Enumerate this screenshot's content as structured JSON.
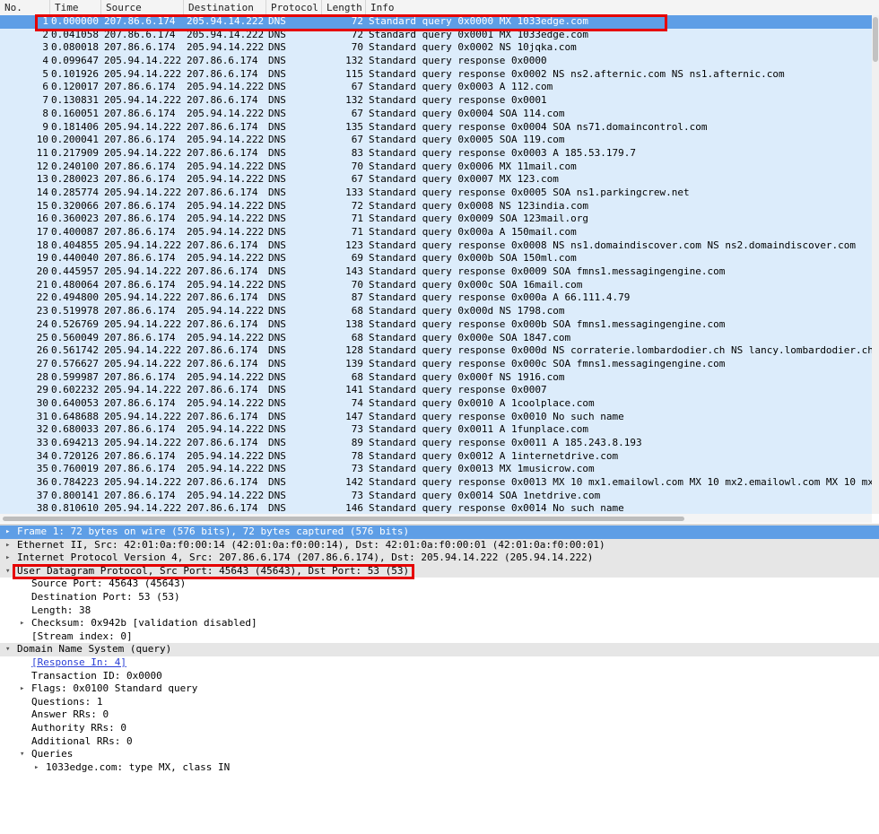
{
  "packet_list": {
    "columns": [
      "No.",
      "Time",
      "Source",
      "Destination",
      "Protocol",
      "Length",
      "Info"
    ],
    "rows": [
      {
        "no": "1",
        "time": "0.000000",
        "src": "207.86.6.174",
        "dst": "205.94.14.222",
        "proto": "DNS",
        "len": "72",
        "info": "Standard query 0x0000  MX 1033edge.com",
        "selected": true
      },
      {
        "no": "2",
        "time": "0.041058",
        "src": "207.86.6.174",
        "dst": "205.94.14.222",
        "proto": "DNS",
        "len": "72",
        "info": "Standard query 0x0001  MX 1033edge.com"
      },
      {
        "no": "3",
        "time": "0.080018",
        "src": "207.86.6.174",
        "dst": "205.94.14.222",
        "proto": "DNS",
        "len": "70",
        "info": "Standard query 0x0002  NS 10jqka.com"
      },
      {
        "no": "4",
        "time": "0.099647",
        "src": "205.94.14.222",
        "dst": "207.86.6.174",
        "proto": "DNS",
        "len": "132",
        "info": "Standard query response 0x0000"
      },
      {
        "no": "5",
        "time": "0.101926",
        "src": "205.94.14.222",
        "dst": "207.86.6.174",
        "proto": "DNS",
        "len": "115",
        "info": "Standard query response 0x0002  NS ns2.afternic.com NS ns1.afternic.com"
      },
      {
        "no": "6",
        "time": "0.120017",
        "src": "207.86.6.174",
        "dst": "205.94.14.222",
        "proto": "DNS",
        "len": "67",
        "info": "Standard query 0x0003  A 112.com"
      },
      {
        "no": "7",
        "time": "0.130831",
        "src": "205.94.14.222",
        "dst": "207.86.6.174",
        "proto": "DNS",
        "len": "132",
        "info": "Standard query response 0x0001"
      },
      {
        "no": "8",
        "time": "0.160051",
        "src": "207.86.6.174",
        "dst": "205.94.14.222",
        "proto": "DNS",
        "len": "67",
        "info": "Standard query 0x0004  SOA 114.com"
      },
      {
        "no": "9",
        "time": "0.181406",
        "src": "205.94.14.222",
        "dst": "207.86.6.174",
        "proto": "DNS",
        "len": "135",
        "info": "Standard query response 0x0004  SOA ns71.domaincontrol.com"
      },
      {
        "no": "10",
        "time": "0.200041",
        "src": "207.86.6.174",
        "dst": "205.94.14.222",
        "proto": "DNS",
        "len": "67",
        "info": "Standard query 0x0005  SOA 119.com"
      },
      {
        "no": "11",
        "time": "0.217909",
        "src": "205.94.14.222",
        "dst": "207.86.6.174",
        "proto": "DNS",
        "len": "83",
        "info": "Standard query response 0x0003  A 185.53.179.7"
      },
      {
        "no": "12",
        "time": "0.240100",
        "src": "207.86.6.174",
        "dst": "205.94.14.222",
        "proto": "DNS",
        "len": "70",
        "info": "Standard query 0x0006  MX 11mail.com"
      },
      {
        "no": "13",
        "time": "0.280023",
        "src": "207.86.6.174",
        "dst": "205.94.14.222",
        "proto": "DNS",
        "len": "67",
        "info": "Standard query 0x0007  MX 123.com"
      },
      {
        "no": "14",
        "time": "0.285774",
        "src": "205.94.14.222",
        "dst": "207.86.6.174",
        "proto": "DNS",
        "len": "133",
        "info": "Standard query response 0x0005  SOA ns1.parkingcrew.net"
      },
      {
        "no": "15",
        "time": "0.320066",
        "src": "207.86.6.174",
        "dst": "205.94.14.222",
        "proto": "DNS",
        "len": "72",
        "info": "Standard query 0x0008  NS 123india.com"
      },
      {
        "no": "16",
        "time": "0.360023",
        "src": "207.86.6.174",
        "dst": "205.94.14.222",
        "proto": "DNS",
        "len": "71",
        "info": "Standard query 0x0009  SOA 123mail.org"
      },
      {
        "no": "17",
        "time": "0.400087",
        "src": "207.86.6.174",
        "dst": "205.94.14.222",
        "proto": "DNS",
        "len": "71",
        "info": "Standard query 0x000a  A 150mail.com"
      },
      {
        "no": "18",
        "time": "0.404855",
        "src": "205.94.14.222",
        "dst": "207.86.6.174",
        "proto": "DNS",
        "len": "123",
        "info": "Standard query response 0x0008  NS ns1.domaindiscover.com NS ns2.domaindiscover.com"
      },
      {
        "no": "19",
        "time": "0.440040",
        "src": "207.86.6.174",
        "dst": "205.94.14.222",
        "proto": "DNS",
        "len": "69",
        "info": "Standard query 0x000b  SOA 150ml.com"
      },
      {
        "no": "20",
        "time": "0.445957",
        "src": "205.94.14.222",
        "dst": "207.86.6.174",
        "proto": "DNS",
        "len": "143",
        "info": "Standard query response 0x0009  SOA fmns1.messagingengine.com"
      },
      {
        "no": "21",
        "time": "0.480064",
        "src": "207.86.6.174",
        "dst": "205.94.14.222",
        "proto": "DNS",
        "len": "70",
        "info": "Standard query 0x000c  SOA 16mail.com"
      },
      {
        "no": "22",
        "time": "0.494800",
        "src": "205.94.14.222",
        "dst": "207.86.6.174",
        "proto": "DNS",
        "len": "87",
        "info": "Standard query response 0x000a  A 66.111.4.79"
      },
      {
        "no": "23",
        "time": "0.519978",
        "src": "207.86.6.174",
        "dst": "205.94.14.222",
        "proto": "DNS",
        "len": "68",
        "info": "Standard query 0x000d  NS 1798.com"
      },
      {
        "no": "24",
        "time": "0.526769",
        "src": "205.94.14.222",
        "dst": "207.86.6.174",
        "proto": "DNS",
        "len": "138",
        "info": "Standard query response 0x000b  SOA fmns1.messagingengine.com"
      },
      {
        "no": "25",
        "time": "0.560049",
        "src": "207.86.6.174",
        "dst": "205.94.14.222",
        "proto": "DNS",
        "len": "68",
        "info": "Standard query 0x000e  SOA 1847.com"
      },
      {
        "no": "26",
        "time": "0.561742",
        "src": "205.94.14.222",
        "dst": "207.86.6.174",
        "proto": "DNS",
        "len": "128",
        "info": "Standard query response 0x000d  NS corraterie.lombardodier.ch NS lancy.lombardodier.ch"
      },
      {
        "no": "27",
        "time": "0.576627",
        "src": "205.94.14.222",
        "dst": "207.86.6.174",
        "proto": "DNS",
        "len": "139",
        "info": "Standard query response 0x000c  SOA fmns1.messagingengine.com"
      },
      {
        "no": "28",
        "time": "0.599987",
        "src": "207.86.6.174",
        "dst": "205.94.14.222",
        "proto": "DNS",
        "len": "68",
        "info": "Standard query 0x000f  NS 1916.com"
      },
      {
        "no": "29",
        "time": "0.602232",
        "src": "205.94.14.222",
        "dst": "207.86.6.174",
        "proto": "DNS",
        "len": "141",
        "info": "Standard query response 0x0007"
      },
      {
        "no": "30",
        "time": "0.640053",
        "src": "207.86.6.174",
        "dst": "205.94.14.222",
        "proto": "DNS",
        "len": "74",
        "info": "Standard query 0x0010  A 1coolplace.com"
      },
      {
        "no": "31",
        "time": "0.648688",
        "src": "205.94.14.222",
        "dst": "207.86.6.174",
        "proto": "DNS",
        "len": "147",
        "info": "Standard query response 0x0010 No such name"
      },
      {
        "no": "32",
        "time": "0.680033",
        "src": "207.86.6.174",
        "dst": "205.94.14.222",
        "proto": "DNS",
        "len": "73",
        "info": "Standard query 0x0011  A 1funplace.com"
      },
      {
        "no": "33",
        "time": "0.694213",
        "src": "205.94.14.222",
        "dst": "207.86.6.174",
        "proto": "DNS",
        "len": "89",
        "info": "Standard query response 0x0011  A 185.243.8.193"
      },
      {
        "no": "34",
        "time": "0.720126",
        "src": "207.86.6.174",
        "dst": "205.94.14.222",
        "proto": "DNS",
        "len": "78",
        "info": "Standard query 0x0012  A 1internetdrive.com"
      },
      {
        "no": "35",
        "time": "0.760019",
        "src": "207.86.6.174",
        "dst": "205.94.14.222",
        "proto": "DNS",
        "len": "73",
        "info": "Standard query 0x0013  MX 1musicrow.com"
      },
      {
        "no": "36",
        "time": "0.784223",
        "src": "205.94.14.222",
        "dst": "207.86.6.174",
        "proto": "DNS",
        "len": "142",
        "info": "Standard query response 0x0013  MX 10 mx1.emailowl.com MX 10 mx2.emailowl.com MX 10 mx"
      },
      {
        "no": "37",
        "time": "0.800141",
        "src": "207.86.6.174",
        "dst": "205.94.14.222",
        "proto": "DNS",
        "len": "73",
        "info": "Standard query 0x0014  SOA 1netdrive.com"
      },
      {
        "no": "38",
        "time": "0.810610",
        "src": "205.94.14.222",
        "dst": "207.86.6.174",
        "proto": "DNS",
        "len": "146",
        "info": "Standard query response 0x0014 No such name"
      }
    ]
  },
  "details": [
    {
      "depth": 0,
      "arrow": "collapsed",
      "text": "Frame 1: 72 bytes on wire (576 bits), 72 bytes captured (576 bits)",
      "style": "sel"
    },
    {
      "depth": 0,
      "arrow": "collapsed",
      "text": "Ethernet II, Src: 42:01:0a:f0:00:14 (42:01:0a:f0:00:14), Dst: 42:01:0a:f0:00:01 (42:01:0a:f0:00:01)",
      "style": "band"
    },
    {
      "depth": 0,
      "arrow": "collapsed",
      "text": "Internet Protocol Version 4, Src: 207.86.6.174 (207.86.6.174), Dst: 205.94.14.222 (205.94.14.222)",
      "style": "band"
    },
    {
      "depth": 0,
      "arrow": "expanded",
      "text": "User Datagram Protocol, Src Port: 45643 (45643), Dst Port: 53 (53)",
      "style": "band"
    },
    {
      "depth": 1,
      "arrow": "none",
      "text": "Source Port: 45643 (45643)"
    },
    {
      "depth": 1,
      "arrow": "none",
      "text": "Destination Port: 53 (53)"
    },
    {
      "depth": 1,
      "arrow": "none",
      "text": "Length: 38"
    },
    {
      "depth": 1,
      "arrow": "collapsed",
      "text": "Checksum: 0x942b [validation disabled]"
    },
    {
      "depth": 1,
      "arrow": "none",
      "text": "[Stream index: 0]"
    },
    {
      "depth": 0,
      "arrow": "expanded",
      "text": "Domain Name System (query)",
      "style": "band"
    },
    {
      "depth": 1,
      "arrow": "none",
      "text": "[Response In: 4]",
      "link": true
    },
    {
      "depth": 1,
      "arrow": "none",
      "text": "Transaction ID: 0x0000"
    },
    {
      "depth": 1,
      "arrow": "collapsed",
      "text": "Flags: 0x0100 Standard query"
    },
    {
      "depth": 1,
      "arrow": "none",
      "text": "Questions: 1"
    },
    {
      "depth": 1,
      "arrow": "none",
      "text": "Answer RRs: 0"
    },
    {
      "depth": 1,
      "arrow": "none",
      "text": "Authority RRs: 0"
    },
    {
      "depth": 1,
      "arrow": "none",
      "text": "Additional RRs: 0"
    },
    {
      "depth": 1,
      "arrow": "expanded",
      "text": "Queries"
    },
    {
      "depth": 2,
      "arrow": "collapsed",
      "text": "1033edge.com: type MX, class IN"
    }
  ],
  "icons": {
    "collapsed": "▸",
    "expanded": "▾"
  },
  "colors": {
    "selection": "#5e9ee6",
    "row_bg": "#dcecfb",
    "highlight_box": "#e60000",
    "link": "#2a3fd6"
  }
}
